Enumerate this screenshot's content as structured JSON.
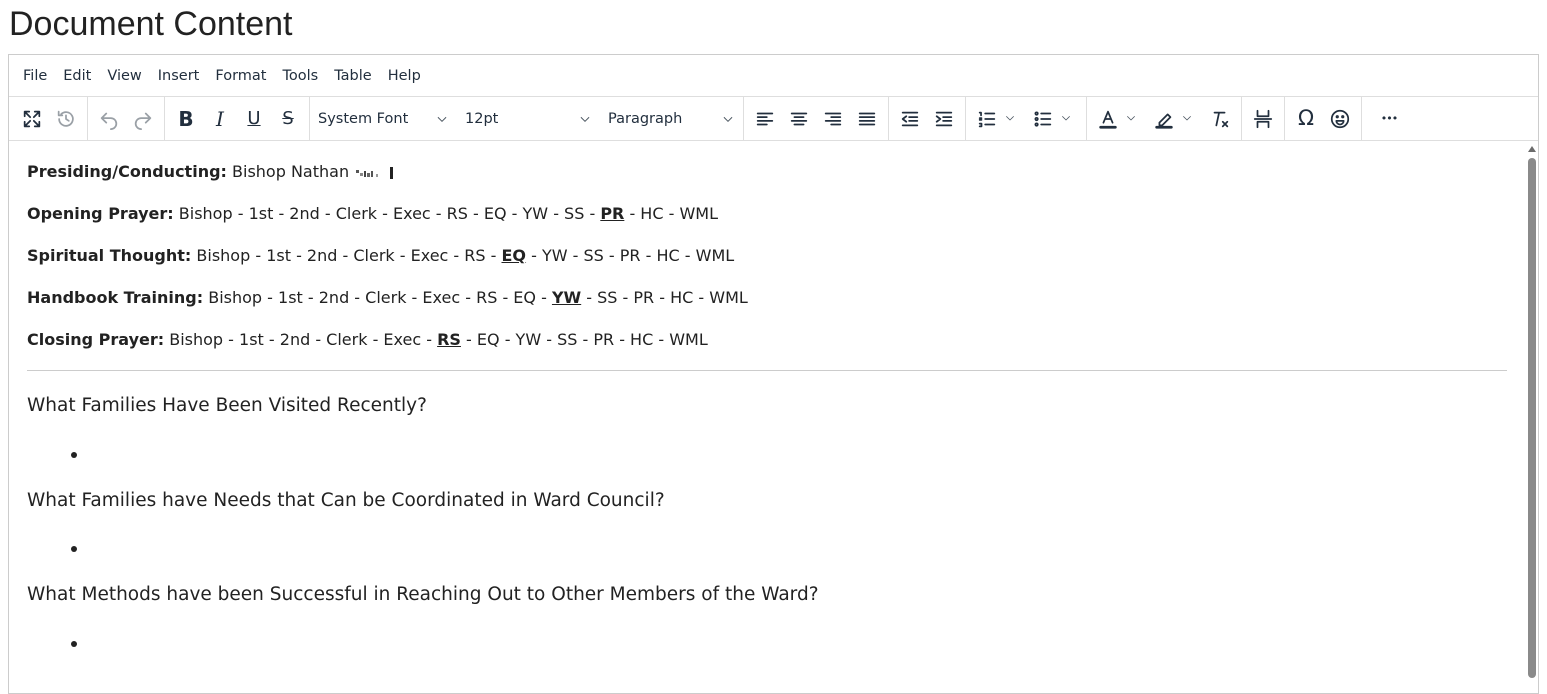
{
  "page": {
    "title": "Document Content"
  },
  "menubar": {
    "items": [
      "File",
      "Edit",
      "View",
      "Insert",
      "Format",
      "Tools",
      "Table",
      "Help"
    ]
  },
  "toolbar": {
    "font_family": "System Font",
    "font_size": "12pt",
    "block_format": "Paragraph",
    "icons": [
      "fullscreen-icon",
      "history-icon",
      "undo-icon",
      "redo-icon",
      "bold-icon",
      "italic-icon",
      "underline-icon",
      "strikethrough-icon",
      "align-left-icon",
      "align-center-icon",
      "align-right-icon",
      "align-justify-icon",
      "outdent-icon",
      "indent-icon",
      "numbered-list-icon",
      "bullet-list-icon",
      "text-color-icon",
      "highlight-icon",
      "clear-formatting-icon",
      "page-break-icon",
      "special-character-icon",
      "emoji-icon",
      "more-icon"
    ],
    "bold_glyph": "B",
    "italic_glyph": "I",
    "underline_glyph": "U",
    "strike_glyph": "S",
    "omega_glyph": "Ω",
    "more_glyph": "•••"
  },
  "content": {
    "assignments": [
      {
        "label": "Presiding/Conducting:",
        "text": "Bishop Nathan"
      },
      {
        "label": "Opening Prayer:",
        "before": "Bishop - 1st - 2nd - Clerk - Exec - RS - EQ - YW - SS - ",
        "highlight": "PR",
        "after": " - HC - WML"
      },
      {
        "label": "Spiritual Thought:",
        "before": "Bishop - 1st - 2nd - Clerk - Exec - RS - ",
        "highlight": "EQ",
        "after": " - YW - SS - PR - HC - WML"
      },
      {
        "label": "Handbook Training:",
        "before": "Bishop - 1st - 2nd - Clerk - Exec - RS - EQ - ",
        "highlight": "YW",
        "after": " - SS - PR - HC - WML"
      },
      {
        "label": "Closing Prayer:",
        "before": "Bishop - 1st - 2nd - Clerk - Exec - ",
        "highlight": "RS",
        "after": " - EQ - YW - SS - PR - HC - WML"
      }
    ],
    "questions": [
      "What Families Have Been Visited Recently?",
      "What Families have Needs that Can be Coordinated in Ward Council?",
      "What Methods have been Successful in Reaching Out to Other Members of the Ward?"
    ]
  }
}
